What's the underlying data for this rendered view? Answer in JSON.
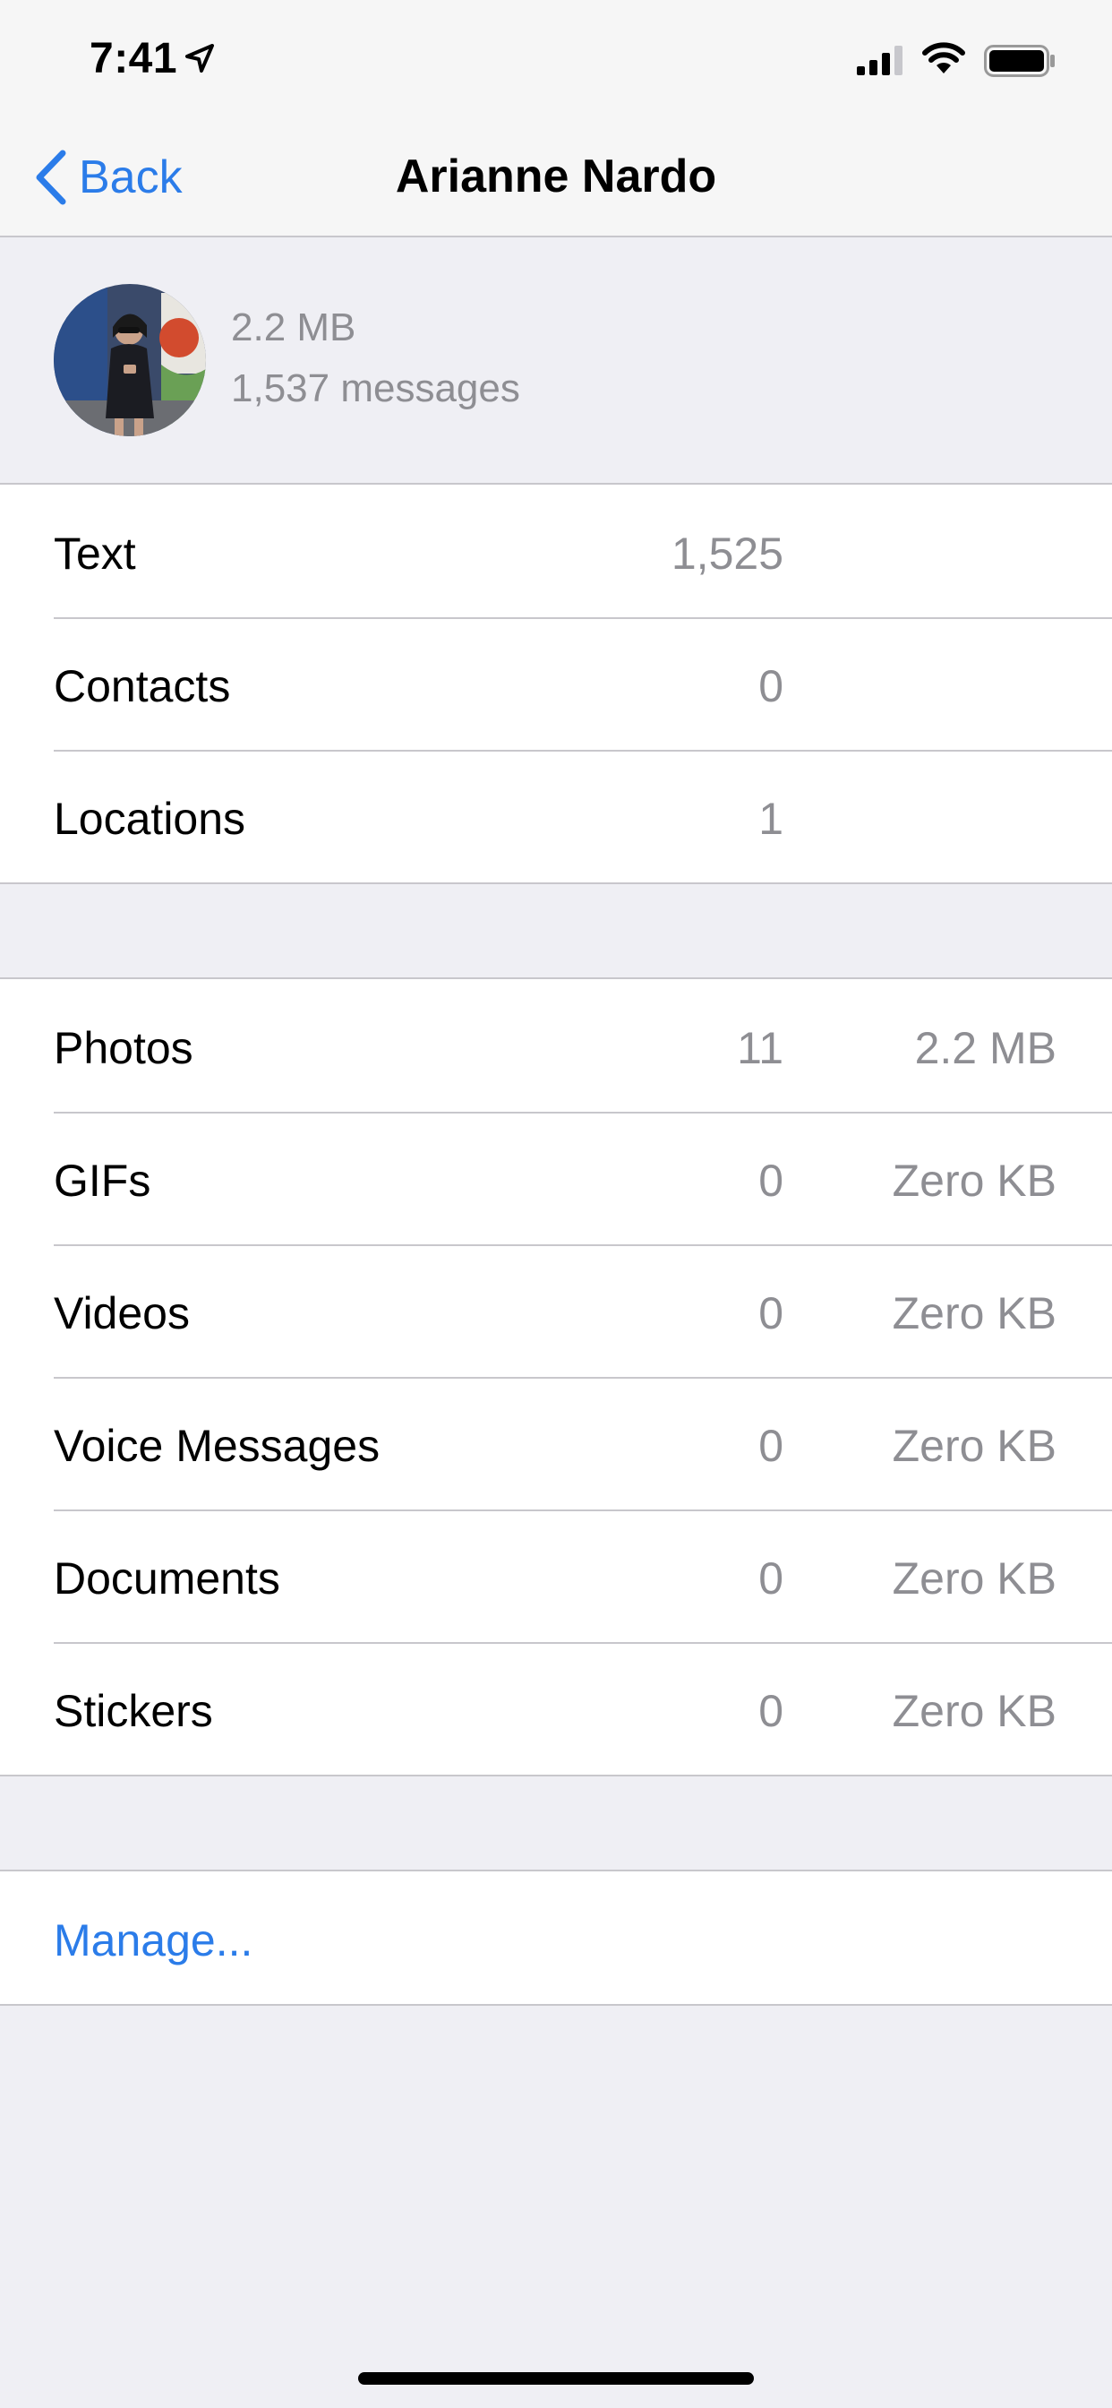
{
  "status_bar": {
    "time": "7:41"
  },
  "nav": {
    "back_label": "Back",
    "title": "Arianne Nardo"
  },
  "summary": {
    "size": "2.2 MB",
    "messages": "1,537 messages"
  },
  "messages_group": [
    {
      "label": "Text",
      "count": "1,525"
    },
    {
      "label": "Contacts",
      "count": "0"
    },
    {
      "label": "Locations",
      "count": "1"
    }
  ],
  "media_group": [
    {
      "label": "Photos",
      "count": "11",
      "size": "2.2 MB"
    },
    {
      "label": "GIFs",
      "count": "0",
      "size": "Zero KB"
    },
    {
      "label": "Videos",
      "count": "0",
      "size": "Zero KB"
    },
    {
      "label": "Voice Messages",
      "count": "0",
      "size": "Zero KB"
    },
    {
      "label": "Documents",
      "count": "0",
      "size": "Zero KB"
    },
    {
      "label": "Stickers",
      "count": "0",
      "size": "Zero KB"
    }
  ],
  "manage": {
    "label": "Manage..."
  },
  "colors": {
    "accent": "#2b7ce9",
    "secondary_text": "#8e8e93",
    "background": "#efeff4"
  },
  "icons": [
    "location-arrow-icon",
    "signal-icon",
    "wifi-icon",
    "battery-icon",
    "back-chevron-icon"
  ]
}
